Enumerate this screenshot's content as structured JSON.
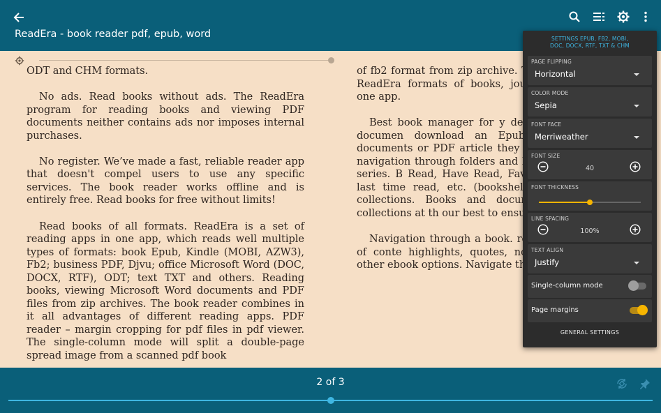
{
  "app": {
    "title": "ReadEra - book reader pdf, epub, word",
    "icons": {
      "back": "arrow-left-icon",
      "search": "search-icon",
      "contents": "list-icon",
      "settings": "gear-icon",
      "more": "more-vertical-icon"
    }
  },
  "reader": {
    "left_paragraphs": [
      "ODT and CHM formats.",
      "No ads. Read books without ads. The ReadEra program for reading books and viewing PDF documents neither contains ads nor imposes internal purchases.",
      "No register. We’ve made a fast, reliable reader app that doesn't compel users to use any specific services. The book reader works offline and is entirely free. Read books for free without limits!",
      "Read books of all formats. ReadEra is a set of reading apps in one app, which reads well multiple types of formats: book Epub, Kindle (MOBI, AZW3), Fb2; business PDF, Djvu; office Microsoft Word (DOC, DOCX, RTF), ODT; text TXT and others. Reading books, viewing Microsoft Word documents and PDF files from zip archives. The book reader combines in it all advantages of different reading apps. PDF reader – margin cropping for pdf files in pdf viewer. The single-column mode will split a double-page spread image from a scanned pdf book"
    ],
    "right_paragraphs": [
      "of fb2 format from zip archive. The reader for books, ReadEra formats of books, journals, documents in one app.",
      "Best book manager for y detection of books and documen download an Epub book, PDF Word documents or PDF article they appear in the reader navigation through folders and books by authors and series. B Read, Have Read, Favorites. S format, the last time read, etc. (bookshelves) allows creating collections. Books and docume one or several collections at th our best to ensure order in your",
      "Navigation through a book. reading settings, table of conte highlights, quotes, notes, page book and other ebook options. Navigate the book"
    ]
  },
  "settings_panel": {
    "header": "SETTINGS EPUB, FB2, MOBI, DOC, DOCX, RTF, TXT & CHM",
    "page_flipping": {
      "label": "PAGE FLIPPING",
      "value": "Horizontal"
    },
    "color_mode": {
      "label": "COLOR MODE",
      "value": "Sepia"
    },
    "font_face": {
      "label": "FONT FACE",
      "value": "Merriweather"
    },
    "font_size": {
      "label": "FONT SIZE",
      "value": "40"
    },
    "font_thickness": {
      "label": "FONT THICKNESS",
      "level": 0.5
    },
    "line_spacing": {
      "label": "LINE SPACING",
      "value": "100%"
    },
    "text_align": {
      "label": "TEXT ALIGN",
      "value": "Justify"
    },
    "single_column": {
      "label": "Single-column mode",
      "on": false
    },
    "page_margins": {
      "label": "Page margins",
      "on": true
    },
    "general_settings": "GENERAL SETTINGS",
    "colors": {
      "accent": "#f7b500",
      "header": "#3fb6e2",
      "panel_bg": "#2c2c2c"
    }
  },
  "bottom": {
    "page_counter": "2 of 3",
    "progress": 0.5,
    "icons": {
      "auto_rotate": "screen-rotation-icon",
      "pin": "pin-icon"
    }
  },
  "colors": {
    "bar": "#0a5f79",
    "page_bg": "#f6dfc6",
    "progress": "#3fb6e2"
  }
}
